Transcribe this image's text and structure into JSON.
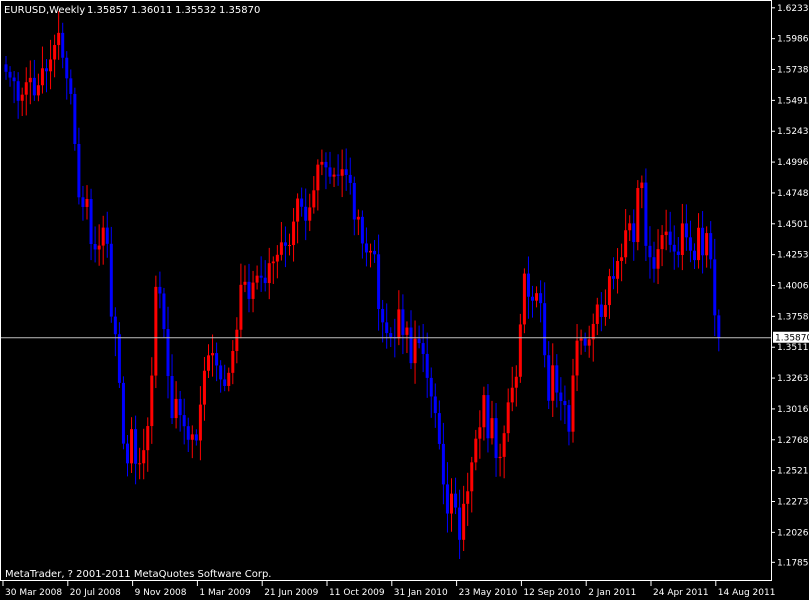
{
  "window": {
    "title": "EURUSD,Weekly",
    "ohlc": [
      "1.35857",
      "1.36011",
      "1.35532",
      "1.35870"
    ],
    "copyright": "MetaTrader, ? 2001-2011 MetaQuotes Software Corp."
  },
  "colors": {
    "background": "#000000",
    "bull": "#ff0000",
    "bear": "#0000ff",
    "axis": "#ffffff",
    "current_price_line": "#c0c0c0"
  },
  "chart_data": {
    "type": "candlestick",
    "symbol": "EURUSD",
    "timeframe": "Weekly",
    "current_price": 1.3587,
    "current_price_label": "1.35870",
    "ylim": [
      1.1748,
      1.6256
    ],
    "y_ticks": [
      1.62335,
      1.5986,
      1.57385,
      1.5491,
      1.52435,
      1.4996,
      1.47485,
      1.4501,
      1.42535,
      1.4006,
      1.37585,
      1.3511,
      1.32635,
      1.3016,
      1.27685,
      1.2521,
      1.22735,
      1.2026,
      1.17855
    ],
    "y_tick_labels": [
      "1.62335",
      "1.59860",
      "1.57385",
      "1.54910",
      "1.52435",
      "1.49960",
      "1.47485",
      "1.45010",
      "1.42535",
      "1.40060",
      "1.37585",
      "1.35110",
      "1.32635",
      "1.30160",
      "1.27685",
      "1.25210",
      "1.22735",
      "1.20260",
      "1.17855"
    ],
    "x_tick_labels": [
      "30 Mar 2008",
      "20 Jul 2008",
      "9 Nov 2008",
      "1 Mar 2009",
      "21 Jun 2009",
      "11 Oct 2009",
      "31 Jan 2010",
      "23 May 2010",
      "12 Sep 2010",
      "2 Jan 2011",
      "24 Apr 2011",
      "14 Aug 2011"
    ],
    "x_tick_index": [
      0,
      16,
      32,
      48,
      64,
      80,
      96,
      112,
      128,
      144,
      160,
      176
    ],
    "grid": false,
    "close_path": [
      [
        0,
        1.572
      ],
      [
        2,
        1.558
      ],
      [
        3,
        1.552
      ],
      [
        5,
        1.568
      ],
      [
        7,
        1.558
      ],
      [
        9,
        1.57
      ],
      [
        11,
        1.58
      ],
      [
        13,
        1.596
      ],
      [
        15,
        1.57
      ],
      [
        16,
        1.555
      ],
      [
        17,
        1.515
      ],
      [
        18,
        1.47
      ],
      [
        20,
        1.465
      ],
      [
        21,
        1.44
      ],
      [
        22,
        1.425
      ],
      [
        23,
        1.44
      ],
      [
        24,
        1.45
      ],
      [
        25,
        1.435
      ],
      [
        26,
        1.375
      ],
      [
        27,
        1.36
      ],
      [
        28,
        1.32
      ],
      [
        29,
        1.27
      ],
      [
        30,
        1.26
      ],
      [
        31,
        1.28
      ],
      [
        32,
        1.265
      ],
      [
        33,
        1.265
      ],
      [
        34,
        1.27
      ],
      [
        35,
        1.282
      ],
      [
        36,
        1.335
      ],
      [
        37,
        1.395
      ],
      [
        38,
        1.392
      ],
      [
        39,
        1.36
      ],
      [
        40,
        1.33
      ],
      [
        41,
        1.29
      ],
      [
        42,
        1.305
      ],
      [
        44,
        1.285
      ],
      [
        46,
        1.275
      ],
      [
        47,
        1.272
      ],
      [
        48,
        1.3
      ],
      [
        49,
        1.33
      ],
      [
        50,
        1.345
      ],
      [
        52,
        1.34
      ],
      [
        53,
        1.33
      ],
      [
        54,
        1.32
      ],
      [
        56,
        1.35
      ],
      [
        57,
        1.365
      ],
      [
        58,
        1.395
      ],
      [
        59,
        1.405
      ],
      [
        60,
        1.395
      ],
      [
        61,
        1.4
      ],
      [
        62,
        1.405
      ],
      [
        63,
        1.4
      ],
      [
        64,
        1.41
      ],
      [
        65,
        1.415
      ],
      [
        66,
        1.425
      ],
      [
        68,
        1.43
      ],
      [
        70,
        1.44
      ],
      [
        72,
        1.465
      ],
      [
        74,
        1.46
      ],
      [
        76,
        1.48
      ],
      [
        78,
        1.5
      ],
      [
        80,
        1.485
      ],
      [
        82,
        1.495
      ],
      [
        84,
        1.49
      ],
      [
        86,
        1.46
      ],
      [
        87,
        1.45
      ],
      [
        88,
        1.43
      ],
      [
        89,
        1.425
      ],
      [
        90,
        1.435
      ],
      [
        91,
        1.42
      ],
      [
        92,
        1.38
      ],
      [
        93,
        1.37
      ],
      [
        94,
        1.36
      ],
      [
        95,
        1.36
      ],
      [
        96,
        1.355
      ],
      [
        97,
        1.38
      ],
      [
        98,
        1.36
      ],
      [
        99,
        1.36
      ],
      [
        100,
        1.345
      ],
      [
        101,
        1.36
      ],
      [
        102,
        1.352
      ],
      [
        103,
        1.345
      ],
      [
        104,
        1.33
      ],
      [
        105,
        1.315
      ],
      [
        106,
        1.3
      ],
      [
        107,
        1.27
      ],
      [
        108,
        1.245
      ],
      [
        109,
        1.225
      ],
      [
        110,
        1.24
      ],
      [
        111,
        1.215
      ],
      [
        112,
        1.19
      ],
      [
        113,
        1.22
      ],
      [
        114,
        1.23
      ],
      [
        115,
        1.26
      ],
      [
        116,
        1.28
      ],
      [
        117,
        1.29
      ],
      [
        118,
        1.305
      ],
      [
        119,
        1.285
      ],
      [
        120,
        1.29
      ],
      [
        121,
        1.27
      ],
      [
        122,
        1.265
      ],
      [
        123,
        1.28
      ],
      [
        124,
        1.3
      ],
      [
        125,
        1.315
      ],
      [
        126,
        1.33
      ],
      [
        127,
        1.375
      ],
      [
        128,
        1.41
      ],
      [
        129,
        1.395
      ],
      [
        130,
        1.395
      ],
      [
        131,
        1.4
      ],
      [
        132,
        1.38
      ],
      [
        133,
        1.35
      ],
      [
        134,
        1.315
      ],
      [
        135,
        1.335
      ],
      [
        136,
        1.31
      ],
      [
        137,
        1.305
      ],
      [
        138,
        1.3
      ],
      [
        139,
        1.285
      ],
      [
        140,
        1.33
      ],
      [
        141,
        1.35
      ],
      [
        142,
        1.36
      ],
      [
        143,
        1.35
      ],
      [
        144,
        1.36
      ],
      [
        145,
        1.375
      ],
      [
        146,
        1.38
      ],
      [
        147,
        1.375
      ],
      [
        148,
        1.39
      ],
      [
        149,
        1.41
      ],
      [
        150,
        1.4
      ],
      [
        151,
        1.415
      ],
      [
        152,
        1.42
      ],
      [
        153,
        1.44
      ],
      [
        154,
        1.45
      ],
      [
        155,
        1.44
      ],
      [
        156,
        1.475
      ],
      [
        157,
        1.48
      ],
      [
        158,
        1.435
      ],
      [
        159,
        1.43
      ],
      [
        160,
        1.41
      ],
      [
        161,
        1.43
      ],
      [
        162,
        1.445
      ],
      [
        163,
        1.45
      ],
      [
        164,
        1.44
      ],
      [
        165,
        1.425
      ],
      [
        166,
        1.43
      ],
      [
        167,
        1.45
      ],
      [
        168,
        1.435
      ],
      [
        169,
        1.43
      ],
      [
        170,
        1.425
      ],
      [
        171,
        1.44
      ],
      [
        172,
        1.43
      ],
      [
        173,
        1.44
      ],
      [
        174,
        1.42
      ],
      [
        175,
        1.37
      ],
      [
        176,
        1.3587
      ]
    ]
  }
}
